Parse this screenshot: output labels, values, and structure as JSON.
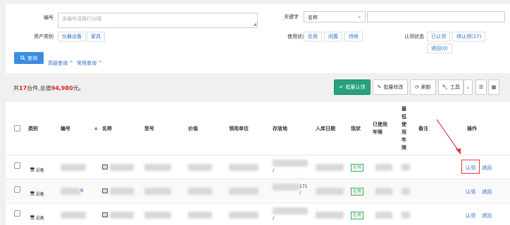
{
  "filters": {
    "id_label": "编号",
    "id_placeholder": "多编号请换行分隔",
    "keyword_label": "关键字",
    "keyword_field": "名称",
    "category_label": "资产类别",
    "category_options": [
      "仪器设备",
      "家具"
    ],
    "status_label": "使用状态",
    "status_options": [
      "在用",
      "闲置",
      "待修"
    ],
    "claim_label": "认领状态",
    "claim_options": [
      "已认领",
      "待认领(17)",
      "退回(0)"
    ],
    "query_button": "查询",
    "advanced_link": "高级查询",
    "common_link": "常用查询"
  },
  "summary": {
    "prefix": "共",
    "count": "17",
    "mid": "台件,总值",
    "value": "94,980",
    "suffix": "元。"
  },
  "toolbar": {
    "batch_claim": "批量认领",
    "batch_edit": "批量修改",
    "refresh": "刷新",
    "tools": "工具"
  },
  "table": {
    "headers": {
      "type": "类别",
      "number": "编号",
      "name": "名称",
      "model": "型号",
      "price": "价值",
      "unit": "领用单位",
      "location": "存放地",
      "date": "入库日期",
      "status": "现状",
      "used_years": "已使用年限",
      "max_years": "最低使用年限",
      "remark": "备注",
      "ops": "操作"
    },
    "rows": [
      {
        "type": "设备",
        "number_visible": "",
        "location_suffix": "/",
        "status": "在用",
        "claim": "认领",
        "return": "退回"
      },
      {
        "type": "设备",
        "number_visible": "6",
        "location_suffix": "171\n/",
        "status": "在用",
        "claim": "认领",
        "return": "退回"
      },
      {
        "type": "设备",
        "number_visible": "",
        "location_suffix": "/",
        "status": "在用",
        "claim": "认领",
        "return": "退回"
      }
    ]
  },
  "colors": {
    "accent_blue": "#3c8dde",
    "link_blue": "#2b6cc4",
    "batch_green": "#27a17c",
    "highlight_red": "#d9251c",
    "status_green": "#2fa84f"
  }
}
